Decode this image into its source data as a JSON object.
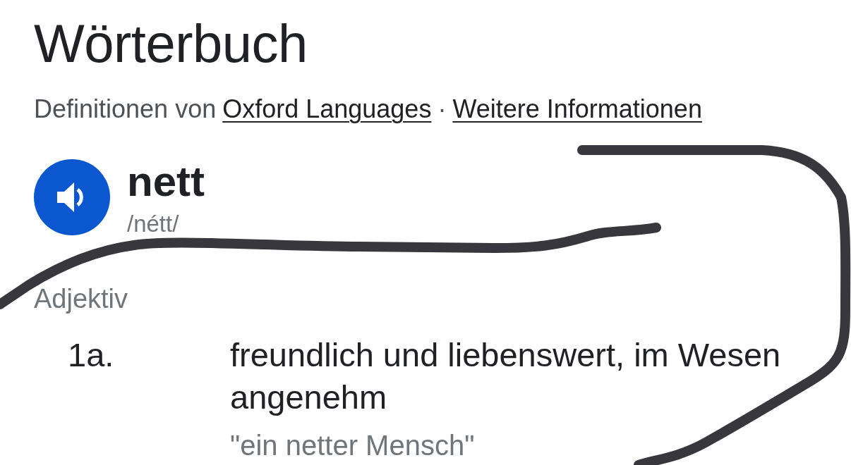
{
  "title": "Wörterbuch",
  "attribution": {
    "prefix": "Definitionen von",
    "separator": "·",
    "links": [
      "Oxford Languages",
      "Weitere Informationen"
    ]
  },
  "entry": {
    "word": "nett",
    "phonetic": "/nétt/",
    "part_of_speech": "Adjektiv",
    "senses": [
      {
        "number": "1a.",
        "definition": "freundlich und liebenswert, im Wesen angenehm",
        "example": "\"ein netter Mensch\""
      }
    ]
  }
}
